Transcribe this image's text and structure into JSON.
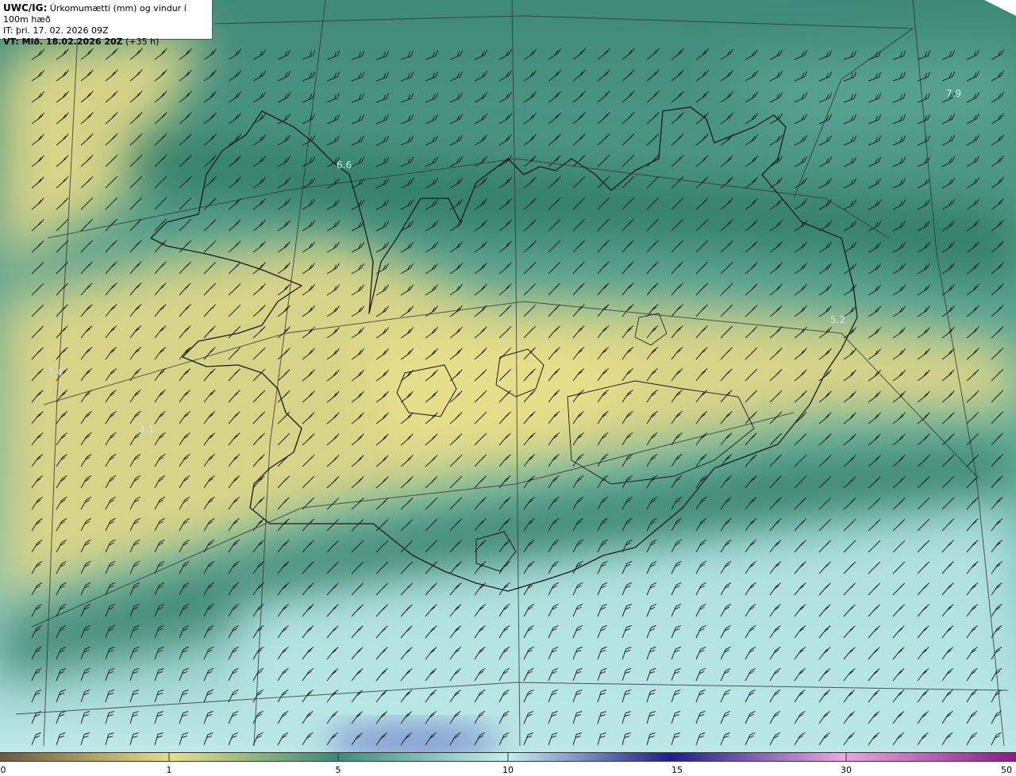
{
  "header": {
    "model_label": "UWC/IG:",
    "parameter": "Úrkomumætti (mm) og vindur í 100m hæð",
    "initial_time": "IT: þri. 17. 02. 2026 09Z",
    "valid_label": "VT: Mið. 18.02.2026 20Z",
    "lead_time": "(+35 h)"
  },
  "map_labels": [
    {
      "name": "label-6-6",
      "text": "6.6"
    },
    {
      "name": "label-7-9",
      "text": "7.9"
    },
    {
      "name": "label-3-4",
      "text": "3.4"
    },
    {
      "name": "label-3-1",
      "text": "3.1"
    },
    {
      "name": "label-5-2",
      "text": "5.2"
    }
  ],
  "colorbar": {
    "ticks": [
      "0",
      "1",
      "5",
      "10",
      "15",
      "30",
      "50"
    ],
    "colors": {
      "brown": "#6b5a3e",
      "yellow": "#e6df8a",
      "teal": "#3f8a78",
      "light_cyan": "#c4eef0",
      "navy": "#1e1e8a",
      "pink": "#e9a8df",
      "purple": "#8a1a8a"
    }
  },
  "map_colors": {
    "dry": "#d8d487",
    "dark_teal": "#2f7a62",
    "mid_teal": "#5aa893",
    "light_teal": "#9fd4cf",
    "pale_cyan": "#b8e8e6",
    "blue_patch": "#7e93d1",
    "coast_line": "#1a1a1a",
    "grid_line": "#333333"
  },
  "icons": [
    "wind-barb-icon"
  ]
}
